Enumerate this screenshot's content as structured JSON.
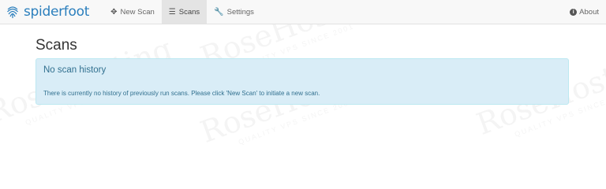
{
  "navbar": {
    "brand_text": "spiderfoot",
    "items": [
      {
        "label": "New Scan",
        "icon": "asterisk-icon"
      },
      {
        "label": "Scans",
        "icon": "list-icon",
        "active": true
      },
      {
        "label": "Settings",
        "icon": "wrench-icon"
      }
    ],
    "about_label": "About",
    "about_icon_glyph": "i"
  },
  "page": {
    "title": "Scans"
  },
  "alert": {
    "heading": "No scan history",
    "text": "There is currently no history of previously run scans. Please click 'New Scan' to initiate a new scan."
  },
  "watermark": {
    "brand": "RoseHosting",
    "tagline": "QUALITY VPS SINCE 2001"
  },
  "colors": {
    "navbar_bg": "#f8f8f8",
    "active_tab_bg": "#e4e4e4",
    "brand": "#2b7fbd",
    "alert_bg": "#d9edf7",
    "alert_border": "#bce8f1",
    "alert_text": "#31708f"
  }
}
